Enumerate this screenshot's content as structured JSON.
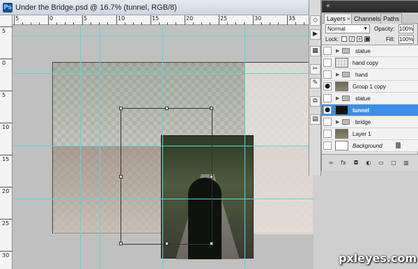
{
  "document": {
    "title": "Under the Bridge.psd @ 16.7% (tunnel, RGB/8)",
    "app_icon": "Ps"
  },
  "rulers": {
    "top_labels": [
      "5",
      "0",
      "5",
      "10",
      "15",
      "20",
      "25",
      "30",
      "35"
    ],
    "left_labels": [
      "5",
      "0",
      "5",
      "10",
      "15",
      "20",
      "25",
      "30"
    ]
  },
  "tools": [
    {
      "name": "pan-icon",
      "glyph": "◇"
    },
    {
      "name": "play-icon",
      "glyph": "▶"
    },
    {
      "name": "crop-icon",
      "glyph": "▦"
    },
    {
      "name": "scissors-icon",
      "glyph": "✂"
    },
    {
      "name": "brush-icon",
      "glyph": "✎"
    },
    {
      "name": "stamp-icon",
      "glyph": "⧉"
    },
    {
      "name": "notes-icon",
      "glyph": "▤"
    }
  ],
  "panel": {
    "collapse_glyph": "«",
    "tabs": [
      {
        "label": "Layers",
        "active": true
      },
      {
        "label": "Channels",
        "active": false
      },
      {
        "label": "Paths",
        "active": false
      }
    ],
    "tab_close": "×",
    "blend_mode": "Normal",
    "opacity_label": "Opacity:",
    "opacity_value": "100%",
    "lock_label": "Lock:",
    "fill_label": "Fill:",
    "fill_value": "100%",
    "layers": [
      {
        "name": "statue",
        "type": "group",
        "visible": false,
        "selected": false,
        "thumb": "folder"
      },
      {
        "name": "hand copy",
        "type": "layer",
        "visible": false,
        "selected": false,
        "thumb": "checker"
      },
      {
        "name": "hand",
        "type": "group",
        "visible": false,
        "selected": false,
        "thumb": "folder"
      },
      {
        "name": "Group 1 copy",
        "type": "layer",
        "visible": true,
        "selected": false,
        "thumb": "photo"
      },
      {
        "name": "statue",
        "type": "group",
        "visible": false,
        "selected": false,
        "thumb": "folder"
      },
      {
        "name": "tunnel",
        "type": "layer",
        "visible": true,
        "selected": true,
        "thumb": "black"
      },
      {
        "name": "bridge",
        "type": "group",
        "visible": false,
        "selected": false,
        "thumb": "folder"
      },
      {
        "name": "Layer 1",
        "type": "layer",
        "visible": false,
        "selected": false,
        "thumb": "photo"
      },
      {
        "name": "Background",
        "type": "background",
        "visible": false,
        "selected": false,
        "thumb": "white",
        "locked": true
      }
    ],
    "bottom_icons": [
      "link-icon",
      "fx-icon",
      "mask-icon",
      "adjustment-icon",
      "folder-icon",
      "new-layer-icon",
      "trash-icon"
    ],
    "fx_label": "fx"
  },
  "watermark": "pxleyes.com",
  "colors": {
    "guide": "#5fd4d4",
    "selection": "#3d8ee6",
    "panel_header": "#2b2b2b"
  }
}
